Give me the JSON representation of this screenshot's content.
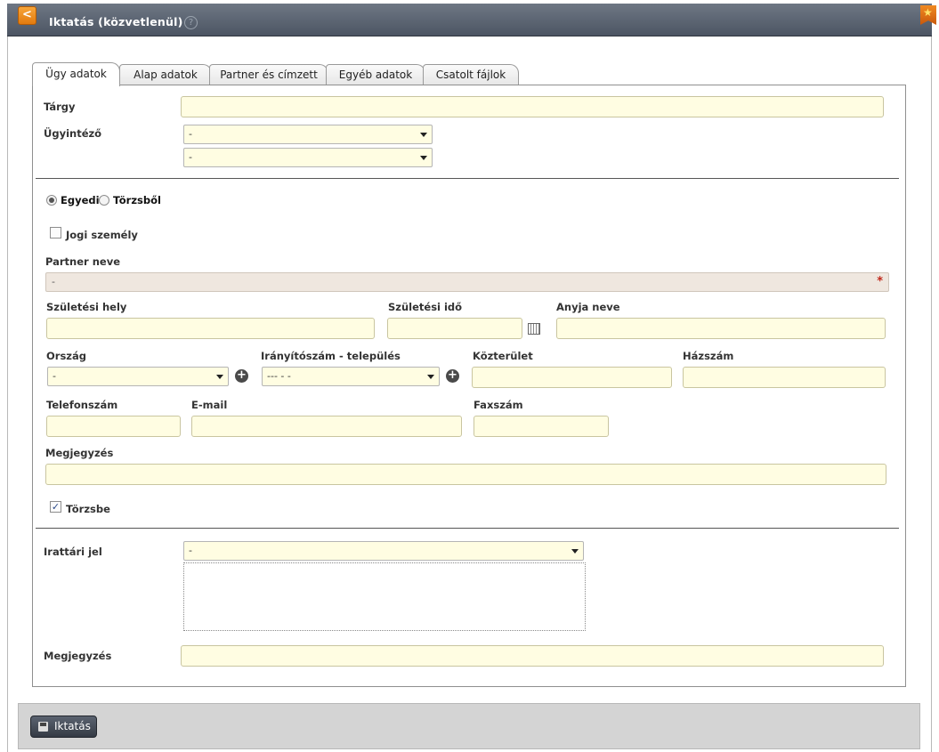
{
  "window": {
    "title": "Iktatás (közvetlenül)",
    "help": "?",
    "back": "<"
  },
  "tabs": [
    {
      "label": "Ügy adatok",
      "active": true
    },
    {
      "label": "Alap adatok"
    },
    {
      "label": "Partner és címzett"
    },
    {
      "label": "Egyéb adatok"
    },
    {
      "label": "Csatolt fájlok"
    }
  ],
  "case": {
    "subject_label": "Tárgy",
    "handler_label": "Ügyintéző",
    "handler_select1": "-",
    "handler_select2": "-"
  },
  "partner": {
    "radio_individual": "Egyedi",
    "radio_registry": "Törzsből",
    "legal_entity_label": "Jogi személy",
    "name_label": "Partner neve",
    "name_value": "-",
    "required_mark": "*",
    "birth_place_label": "Születési hely",
    "birth_date_label": "Születési idő",
    "mother_name_label": "Anyja neve",
    "country_label": "Ország",
    "country_value": "-",
    "zip_city_label": "Irányítószám - település",
    "zip_city_value": "--- - -",
    "street_label": "Közterület",
    "house_no_label": "Házszám",
    "phone_label": "Telefonszám",
    "email_label": "E-mail",
    "fax_label": "Faxszám",
    "note_label": "Megjegyzés",
    "save_to_registry_label": "Törzsbe",
    "save_to_registry_checked": true
  },
  "filing": {
    "archive_code_label": "Irattári jel",
    "archive_code_value": "-",
    "note_label": "Megjegyzés"
  },
  "footer": {
    "submit_label": "Iktatás"
  }
}
